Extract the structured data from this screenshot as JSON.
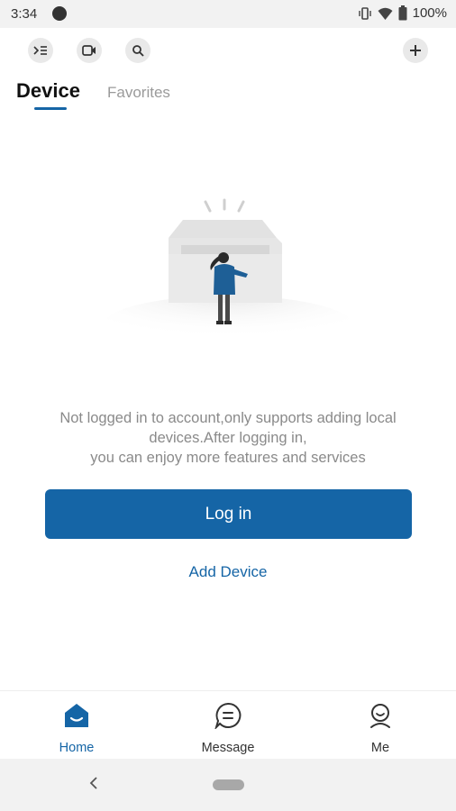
{
  "status_bar": {
    "time": "3:34",
    "battery": "100%"
  },
  "toolbar": {
    "icons": [
      "terminal-list-icon",
      "video-camera-icon",
      "search-icon",
      "plus-icon"
    ]
  },
  "tabs": [
    {
      "label": "Device",
      "active": true
    },
    {
      "label": "Favorites",
      "active": false
    }
  ],
  "empty_state": {
    "illustration": "empty-box-person-illustration",
    "message_lines": [
      "Not logged in to account,only supports adding local",
      "devices.After logging in,",
      "you can enjoy more features and services"
    ]
  },
  "actions": {
    "login_label": "Log in",
    "add_device_label": "Add Device"
  },
  "bottom_nav": [
    {
      "label": "Home",
      "icon": "home-icon",
      "active": true
    },
    {
      "label": "Message",
      "icon": "message-icon",
      "active": false
    },
    {
      "label": "Me",
      "icon": "profile-icon",
      "active": false
    }
  ],
  "colors": {
    "accent": "#1565a6",
    "muted_text": "#8a8a8a",
    "status_bar_bg": "#f2f2f2"
  }
}
